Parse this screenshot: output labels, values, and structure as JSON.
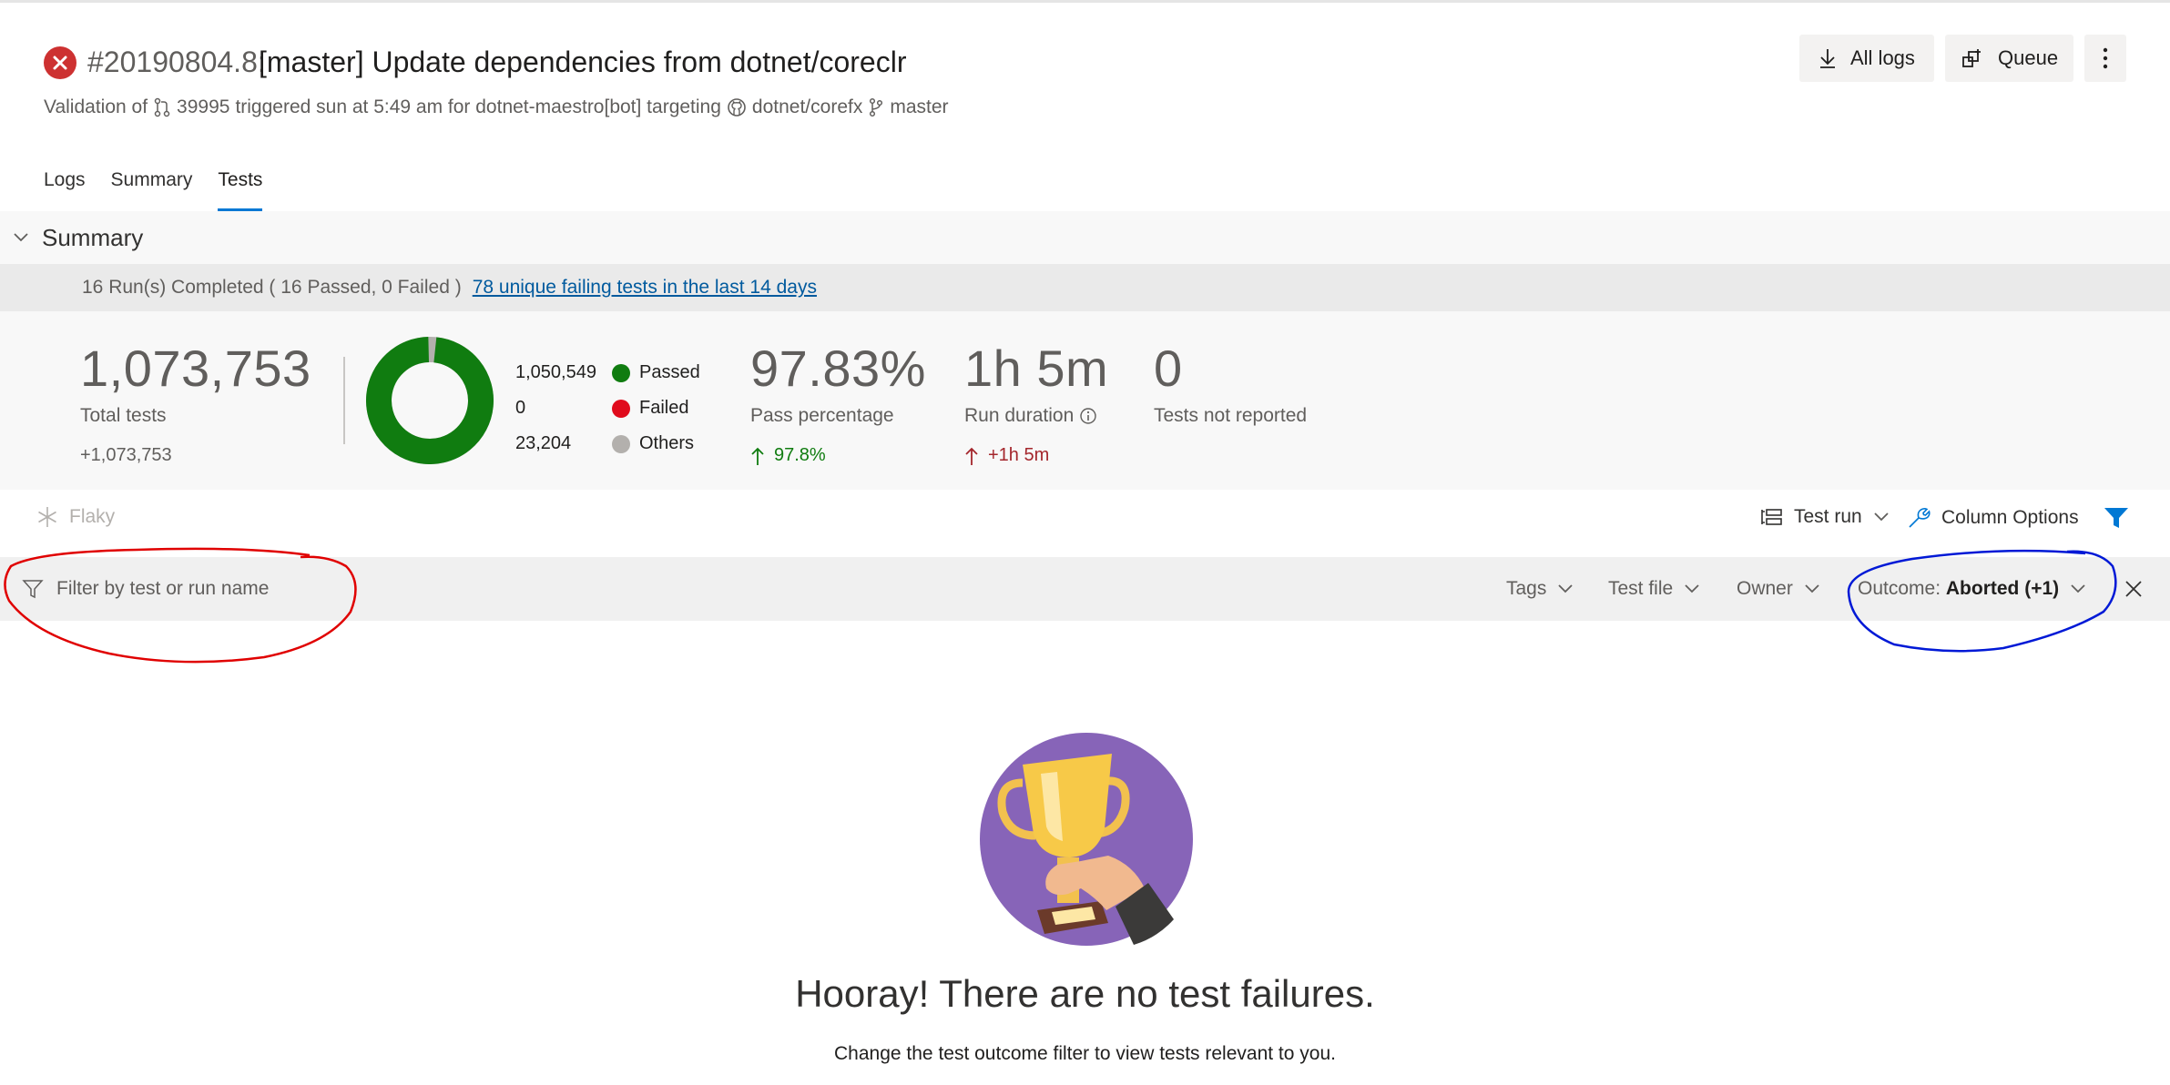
{
  "build": {
    "number": "#20190804.8:",
    "title": "[master] Update dependencies from dotnet/coreclr",
    "sub_prefix": "Validation of",
    "pr_number": "39995",
    "sub_trigger": "triggered sun at 5:49 am for dotnet-maestro[bot] targeting",
    "repo": "dotnet/corefx",
    "branch": "master",
    "status_color": "#cd3131"
  },
  "header_buttons": {
    "all_logs": "All logs",
    "queue": "Queue"
  },
  "tabs": [
    {
      "label": "Logs",
      "active": false
    },
    {
      "label": "Summary",
      "active": false
    },
    {
      "label": "Tests",
      "active": true
    }
  ],
  "summary": {
    "heading": "Summary",
    "runs_text": "16 Run(s) Completed ( 16 Passed, 0 Failed )",
    "failing_link": "78 unique failing tests in the last 14 days",
    "total": {
      "value": "1,073,753",
      "label": "Total tests",
      "delta": "+1,073,753"
    },
    "breakdown": {
      "passed": {
        "count": "1,050,549",
        "label": "Passed",
        "color": "#107c10",
        "value": 1050549
      },
      "failed": {
        "count": "0",
        "label": "Failed",
        "color": "#e00b1c",
        "value": 0
      },
      "others": {
        "count": "23,204",
        "label": "Others",
        "color": "#b3b0ad",
        "value": 23204
      }
    },
    "pass_pct": {
      "value": "97.83%",
      "label": "Pass percentage",
      "delta": "97.8%",
      "delta_color": "#107c10"
    },
    "duration": {
      "value": "1h 5m",
      "label": "Run duration",
      "delta": "+1h 5m",
      "delta_color": "#a4262c"
    },
    "not_reported": {
      "value": "0",
      "label": "Tests not reported"
    }
  },
  "toolbar": {
    "flaky": "Flaky",
    "test_run": "Test run",
    "column_options": "Column Options",
    "accent": "#0078d4"
  },
  "filters": {
    "placeholder": "Filter by test or run name",
    "tags": "Tags",
    "test_file": "Test file",
    "owner": "Owner",
    "outcome_label": "Outcome:",
    "outcome_value": "Aborted (+1)"
  },
  "empty_state": {
    "title": "Hooray! There are no test failures.",
    "hint": "Change the test outcome filter to view tests relevant to you."
  }
}
